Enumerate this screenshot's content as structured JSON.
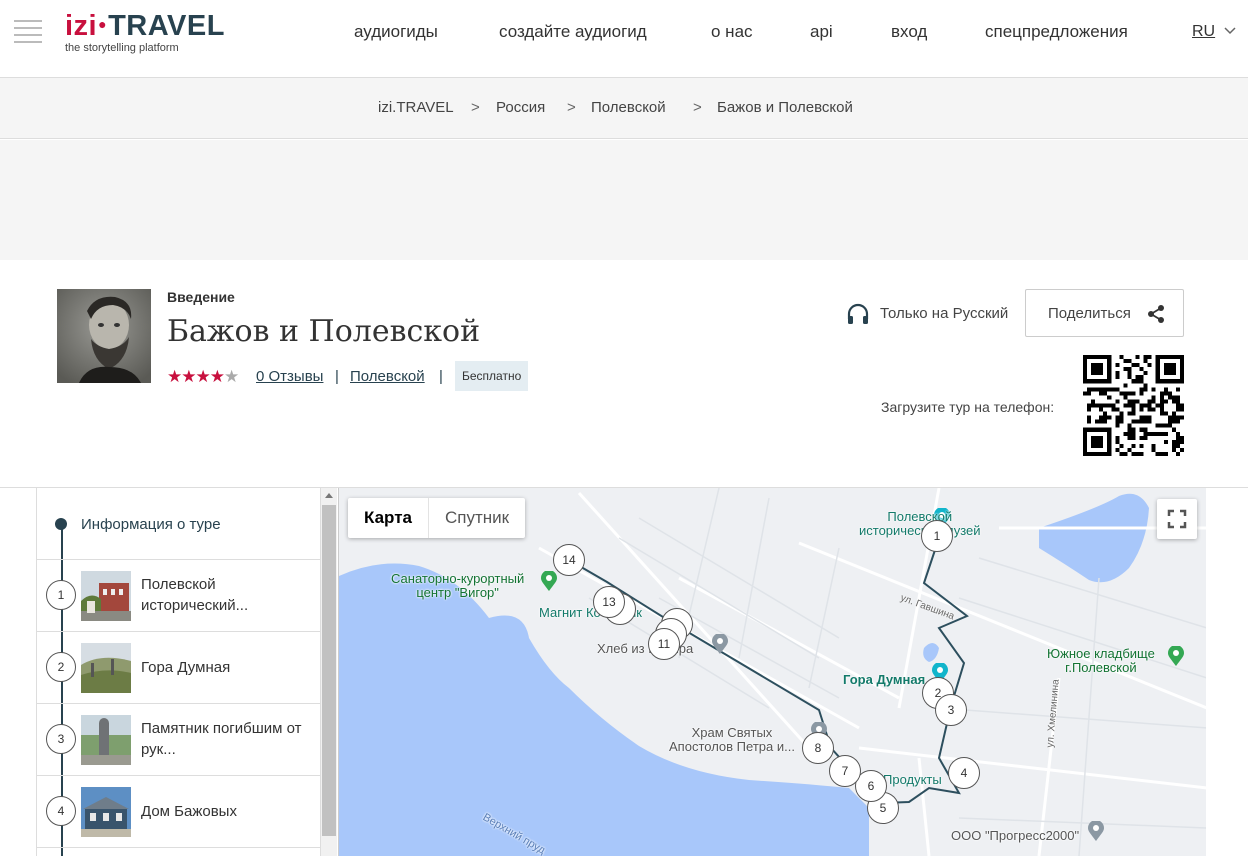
{
  "header": {
    "logo_izi": "izi",
    "logo_travel": "TRAVEL",
    "logo_tagline": "the storytelling platform",
    "nav": [
      "аудиогиды",
      "создайте аудиогид",
      "о нас",
      "api",
      "вход",
      "спецпредложения"
    ],
    "language": "RU"
  },
  "breadcrumb": [
    "izi.TRAVEL",
    "Россия",
    "Полевской",
    "Бажов и Полевской"
  ],
  "breadcrumb_separator": ">",
  "tour": {
    "category": "Введение",
    "title": "Бажов и Полевской",
    "rating": 4,
    "rating_max": 5,
    "reviews_link": "0 Отзывы",
    "city_link": "Полевской",
    "price_badge": "Бесплатно",
    "language_note": "Только на Русский",
    "share_label": "Поделиться",
    "qr_label": "Загрузите тур на телефон:"
  },
  "sidebar": {
    "info_label": "Информация о туре",
    "items": [
      {
        "number": "1",
        "label": "Полевской исторический..."
      },
      {
        "number": "2",
        "label": "Гора Думная"
      },
      {
        "number": "3",
        "label": "Памятник погибшим от рук..."
      },
      {
        "number": "4",
        "label": "Дом Бажовых"
      }
    ]
  },
  "map": {
    "tabs": [
      "Карта",
      "Спутник"
    ],
    "active_tab": "Карта",
    "labels": {
      "museum": "Полевской\nисторический музей",
      "sanatorium": "Санаторно-курортный\nцентр \"Вигор\"",
      "magnit": "Магнит Косметик",
      "bread": "Хлеб из Кудыра",
      "dumnaya": "Гора Думная",
      "cemetery": "Южное кладбище\nг.Полевской",
      "church": "Храм Святых\nАпостолов Петра и...",
      "products": "Продукты",
      "progress": "ООО \"Прогресс2000\"",
      "street_gavshina": "ул. Гавшина",
      "street_khmelinina": "ул. Хмелинина",
      "lake": "Верхний пруд"
    },
    "markers": [
      "1",
      "2",
      "3",
      "4",
      "5",
      "6",
      "7",
      "8",
      "11",
      "13",
      "14"
    ]
  },
  "colors": {
    "brand_red": "#c8103e",
    "brand_dark": "#28424f",
    "route": "#2d4f5e",
    "water": "#a8c7fa"
  }
}
